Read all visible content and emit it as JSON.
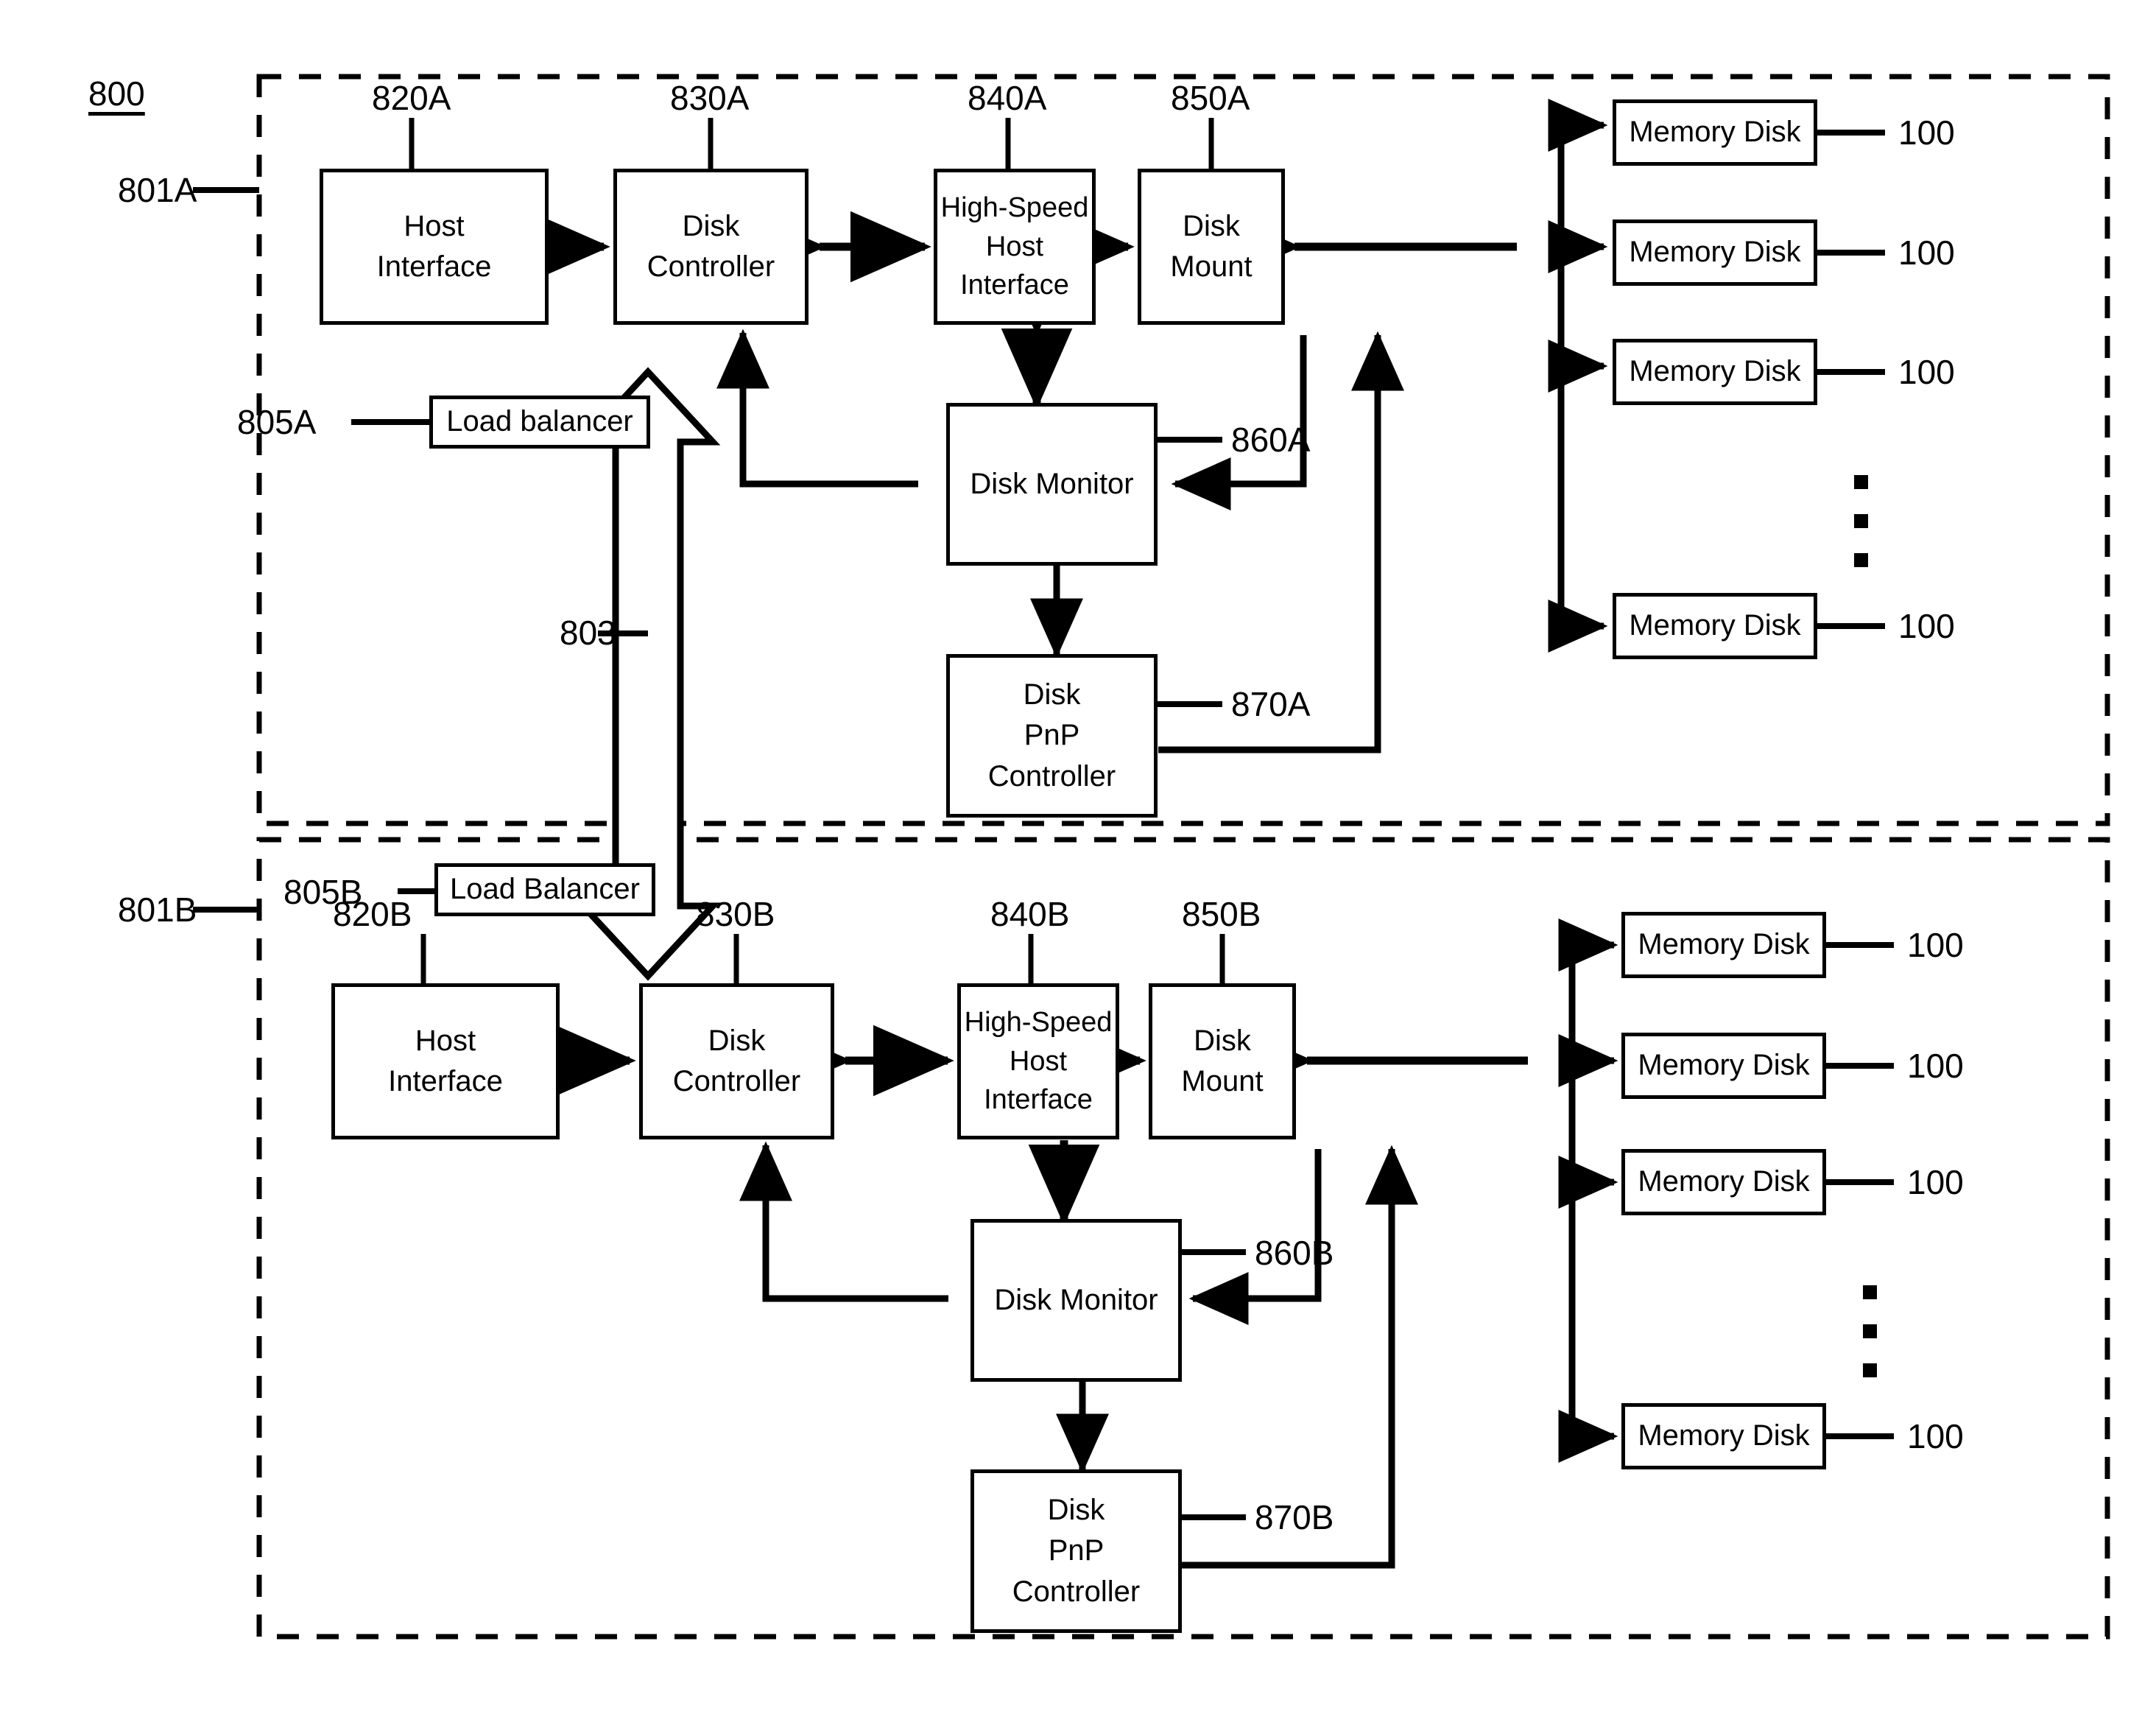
{
  "figure": {
    "number": "800"
  },
  "colors": {
    "line": "#000000",
    "background": "#ffffff"
  },
  "panels": [
    {
      "id": "panelA",
      "ref": "801A"
    },
    {
      "id": "panelB",
      "ref": "801B"
    }
  ],
  "shared": {
    "bus_ref": "803",
    "memory_disk_label": "Memory Disk",
    "memory_disk_ref": "100",
    "vertical_ellipsis": "⋮"
  },
  "system_a": {
    "ref": "801A",
    "load_balancer": {
      "label": "Load balancer",
      "ref": "805A"
    },
    "host_interface": {
      "label": "Host\nInterface",
      "line1": "Host",
      "line2": "Interface",
      "ref": "820A"
    },
    "disk_controller": {
      "label": "Disk\nController",
      "line1": "Disk",
      "line2": "Controller",
      "ref": "830A"
    },
    "high_speed_host_interface": {
      "label": "High-Speed\nHost Interface",
      "line1": "High-Speed",
      "line2": "Host Interface",
      "ref": "840A"
    },
    "disk_mount": {
      "label": "Disk\nMount",
      "line1": "Disk",
      "line2": "Mount",
      "ref": "850A"
    },
    "disk_monitor": {
      "label": "Disk Monitor",
      "ref": "860A"
    },
    "disk_pnp_controller": {
      "label": "Disk\nPnP\nController",
      "line1": "Disk",
      "line2": "PnP",
      "line3": "Controller",
      "ref": "870A"
    },
    "memory_disks": [
      {
        "label": "Memory Disk",
        "ref": "100"
      },
      {
        "label": "Memory Disk",
        "ref": "100"
      },
      {
        "label": "Memory Disk",
        "ref": "100"
      },
      {
        "label": "Memory Disk",
        "ref": "100"
      }
    ]
  },
  "system_b": {
    "ref": "801B",
    "load_balancer": {
      "label": "Load Balancer",
      "ref": "805B"
    },
    "host_interface": {
      "label": "Host\nInterface",
      "line1": "Host",
      "line2": "Interface",
      "ref": "820B"
    },
    "disk_controller": {
      "label": "Disk\nController",
      "line1": "Disk",
      "line2": "Controller",
      "ref": "830B"
    },
    "high_speed_host_interface": {
      "label": "High-Speed\nHost Interface",
      "line1": "High-Speed",
      "line2": "Host Interface",
      "ref": "840B"
    },
    "disk_mount": {
      "label": "Disk\nMount",
      "line1": "Disk",
      "line2": "Mount",
      "ref": "850B"
    },
    "disk_monitor": {
      "label": "Disk Monitor",
      "ref": "860B"
    },
    "disk_pnp_controller": {
      "label": "Disk\nPnP\nController",
      "line1": "Disk",
      "line2": "PnP",
      "line3": "Controller",
      "ref": "870B"
    },
    "memory_disks": [
      {
        "label": "Memory Disk",
        "ref": "100"
      },
      {
        "label": "Memory Disk",
        "ref": "100"
      },
      {
        "label": "Memory Disk",
        "ref": "100"
      },
      {
        "label": "Memory Disk",
        "ref": "100"
      }
    ]
  }
}
